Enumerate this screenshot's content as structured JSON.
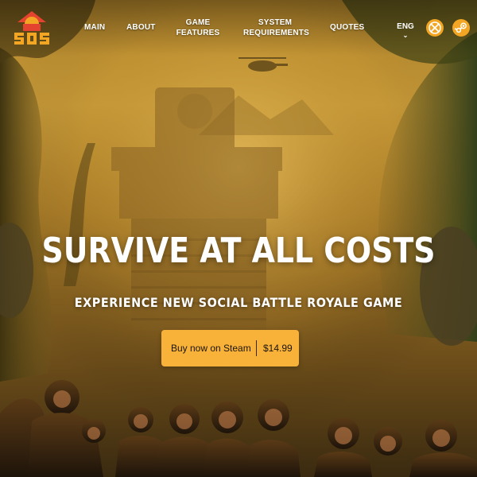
{
  "header": {
    "logo_text": "SOS",
    "nav": {
      "main": "MAIN",
      "about": "ABOUT",
      "game_features_line1": "GAME",
      "game_features_line2": "FEATURES",
      "system_requirements_line1": "SYSTEM",
      "system_requirements_line2": "REQUIREMENTS",
      "quotes": "QUOTES"
    },
    "language": {
      "selected": "ENG",
      "chevron": "⌄"
    },
    "platforms": [
      {
        "icon": "xbox-icon"
      },
      {
        "icon": "steam-icon"
      }
    ]
  },
  "hero": {
    "title": "SURVIVE AT ALL COSTS",
    "subtitle": "EXPERIENCE NEW SOCIAL BATTLE ROYALE GAME",
    "cta": {
      "label": "Buy now on Steam",
      "price": "$14.99"
    }
  },
  "colors": {
    "accent": "#f8b23a",
    "logo_red": "#e4432f",
    "logo_orange": "#f3a623",
    "text": "#ffffff"
  }
}
